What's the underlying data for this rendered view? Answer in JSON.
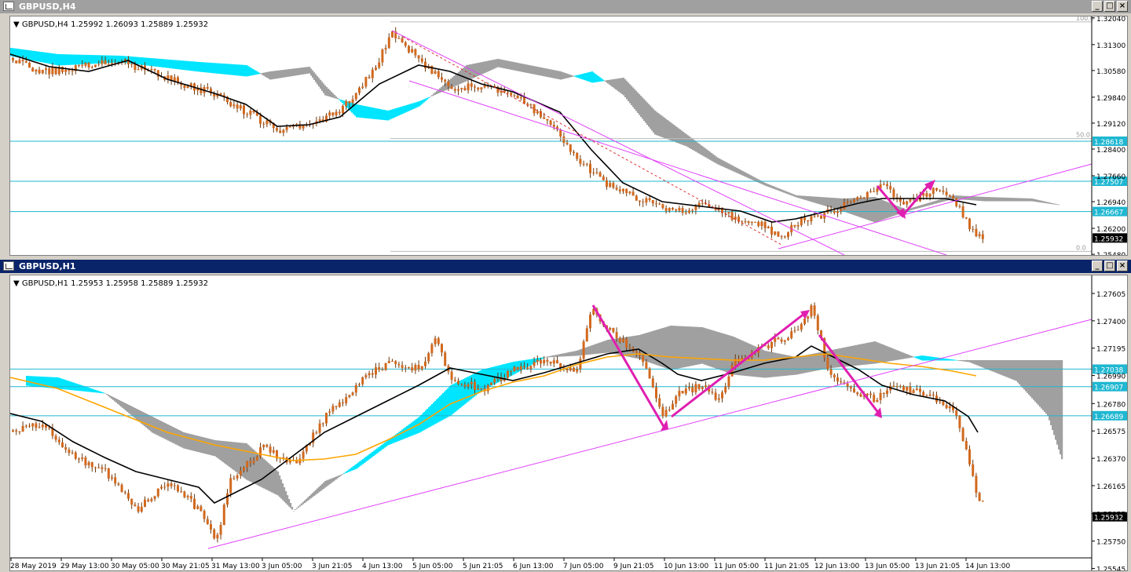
{
  "windows": [
    {
      "id": "h4",
      "title": "GBPUSD,H4",
      "active": false,
      "info": "GBPUSD,H4  1.25992 1.26093 1.25889 1.25932",
      "price_ticks": [
        "1.32040",
        "1.31300",
        "1.30580",
        "1.29840",
        "1.29120",
        "1.28400",
        "1.27660",
        "1.26940",
        "1.26200",
        "1.25480"
      ],
      "price_range": [
        1.2546,
        1.3208
      ],
      "levels": [
        {
          "label": "1.28618",
          "value": 1.28618,
          "color": "#1fb7d1"
        },
        {
          "label": "1.27507",
          "value": 1.27507,
          "color": "#1fb7d1"
        },
        {
          "label": "1.26667",
          "value": 1.26667,
          "color": "#1fb7d1"
        }
      ],
      "current": {
        "label": "1.25932",
        "value": 1.25932
      },
      "fibo": [
        {
          "label": "100.0",
          "value": 1.3193
        },
        {
          "label": "50.0",
          "value": 1.2869
        },
        {
          "label": "0.0",
          "value": 1.2556
        }
      ]
    },
    {
      "id": "h1",
      "title": "GBPUSD,H1",
      "active": true,
      "info": "GBPUSD,H1  1.25953 1.25958 1.25889 1.25932",
      "price_ticks": [
        "1.27605",
        "1.27400",
        "1.27195",
        "1.26990",
        "1.26780",
        "1.26575",
        "1.26370",
        "1.26165",
        "1.25955",
        "1.25750",
        "1.25545"
      ],
      "price_range": [
        1.2553,
        1.2774
      ],
      "levels": [
        {
          "label": "1.27038",
          "value": 1.27038,
          "color": "#1fb7d1"
        },
        {
          "label": "1.26907",
          "value": 1.26907,
          "color": "#1fb7d1"
        },
        {
          "label": "1.26689",
          "value": 1.26689,
          "color": "#1fb7d1"
        }
      ],
      "current": {
        "label": "1.25932",
        "value": 1.25932
      },
      "time_labels": [
        "28 May 2019",
        "29 May 13:00",
        "30 May 05:00",
        "30 May 21:05",
        "31 May 13:00",
        "3 Jun 05:00",
        "3 Jun 21:05",
        "4 Jun 13:00",
        "5 Jun 05:00",
        "5 Jun 21:05",
        "6 Jun 13:00",
        "7 Jun 05:00",
        "9 Jun 21:05",
        "10 Jun 13:00",
        "11 Jun 05:00",
        "11 Jun 21:05",
        "12 Jun 13:00",
        "13 Jun 05:00",
        "13 Jun 21:05",
        "14 Jun 13:00"
      ]
    }
  ],
  "colors": {
    "bull": "#d2691e",
    "bear": "#d2691e",
    "cloud_up": "#00e5ff",
    "cloud_down": "#a0a0a0",
    "ma_fast": "#000000",
    "ma_slow": "#ffa500",
    "channel": "#e040fb",
    "arrow": "#e01fb0"
  }
}
